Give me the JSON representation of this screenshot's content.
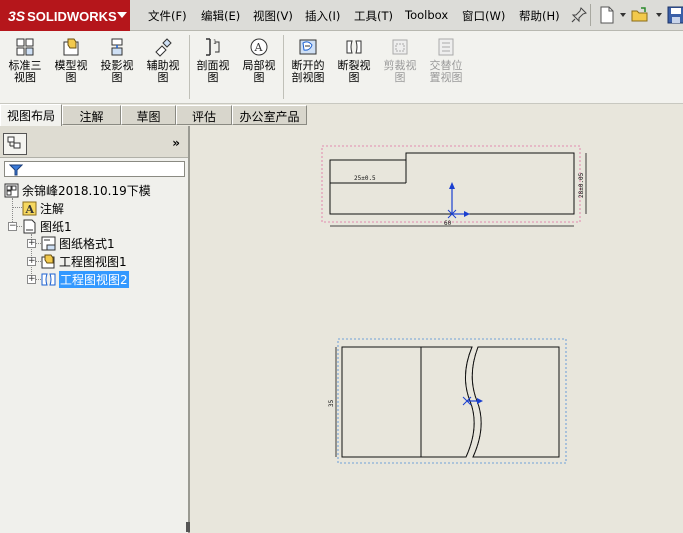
{
  "app": {
    "logo_prefix": "3S",
    "logo_text": "SOLIDWORKS"
  },
  "menu": [
    {
      "label": "文件(F)"
    },
    {
      "label": "编辑(E)"
    },
    {
      "label": "视图(V)"
    },
    {
      "label": "插入(I)"
    },
    {
      "label": "工具(T)"
    },
    {
      "label": "Toolbox"
    },
    {
      "label": "窗口(W)"
    },
    {
      "label": "帮助(H)"
    }
  ],
  "commands": [
    {
      "label": "标准三\n视图",
      "icon": "standard-3-view-icon",
      "enabled": true
    },
    {
      "label": "模型视\n图",
      "icon": "model-view-icon",
      "enabled": true
    },
    {
      "label": "投影视\n图",
      "icon": "projected-view-icon",
      "enabled": true
    },
    {
      "label": "辅助视\n图",
      "icon": "auxiliary-view-icon",
      "enabled": true
    },
    {
      "label": "剖面视\n图",
      "icon": "section-view-icon",
      "enabled": true
    },
    {
      "label": "局部视\n图",
      "icon": "detail-view-icon",
      "enabled": true
    },
    {
      "label": "断开的\n剖视图",
      "icon": "broken-out-section-icon",
      "enabled": true
    },
    {
      "label": "断裂视\n图",
      "icon": "break-view-icon",
      "enabled": true
    },
    {
      "label": "剪裁视\n图",
      "icon": "crop-view-icon",
      "enabled": false
    },
    {
      "label": "交替位\n置视图",
      "icon": "alternate-position-view-icon",
      "enabled": false
    }
  ],
  "tabs": [
    {
      "label": "视图布局",
      "active": true
    },
    {
      "label": "注解",
      "active": false
    },
    {
      "label": "草图",
      "active": false
    },
    {
      "label": "评估",
      "active": false
    },
    {
      "label": "办公室产品",
      "active": false
    }
  ],
  "tree": {
    "root": "余锦峰2018.10.19下模",
    "annotations": "注解",
    "sheet": "图纸1",
    "sheet_format": "图纸格式1",
    "view1": "工程图视图1",
    "view2": "工程图视图2"
  },
  "drawing": {
    "dim_top_width": "25±0.5",
    "dim_right_height": "28±0.05",
    "dim_bottom_width": "60",
    "dim_lower_height": "35"
  }
}
